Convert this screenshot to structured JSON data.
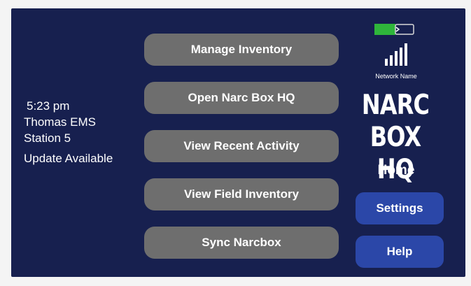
{
  "status": {
    "time": "5:23 pm",
    "organization": "Thomas EMS",
    "station": "Station 5",
    "update": "Update Available"
  },
  "menu": [
    {
      "label": "Manage Inventory"
    },
    {
      "label": "Open Narc Box HQ"
    },
    {
      "label": "View Recent Activity"
    },
    {
      "label": "View Field Inventory"
    },
    {
      "label": "Sync Narcbox"
    }
  ],
  "device": {
    "battery_icon": "battery-icon",
    "signal_icon": "signal-strength-icon",
    "network_name": "Network Name"
  },
  "brand": {
    "line1": "NARC",
    "line2": "BOX HQ",
    "page": "Home"
  },
  "actions": {
    "settings_label": "Settings",
    "help_label": "Help"
  },
  "colors": {
    "background": "#17204f",
    "menu_button": "#6e6e6e",
    "action_button": "#2b47a8",
    "battery_fill": "#2fb53b"
  }
}
